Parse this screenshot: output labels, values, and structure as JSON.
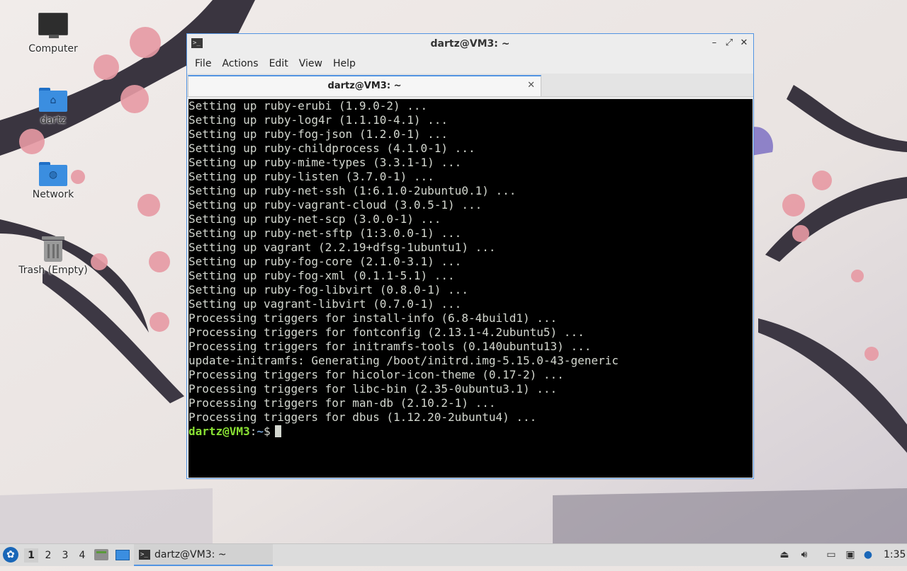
{
  "desktop": {
    "icons": [
      {
        "label": "Computer",
        "icon": "computer-icon"
      },
      {
        "label": "dartz",
        "icon": "home-folder-icon"
      },
      {
        "label": "Network",
        "icon": "network-folder-icon"
      },
      {
        "label": "Trash (Empty)",
        "icon": "trash-icon"
      }
    ]
  },
  "window": {
    "title": "dartz@VM3: ~",
    "controls": {
      "minimize": "–",
      "maximize": "⤢",
      "close": "✕"
    },
    "menu": [
      "File",
      "Actions",
      "Edit",
      "View",
      "Help"
    ],
    "tab": {
      "label": "dartz@VM3: ~",
      "close": "✕"
    }
  },
  "terminal": {
    "lines": [
      "Setting up ruby-erubi (1.9.0-2) ...",
      "Setting up ruby-log4r (1.1.10-4.1) ...",
      "Setting up ruby-fog-json (1.2.0-1) ...",
      "Setting up ruby-childprocess (4.1.0-1) ...",
      "Setting up ruby-mime-types (3.3.1-1) ...",
      "Setting up ruby-listen (3.7.0-1) ...",
      "Setting up ruby-net-ssh (1:6.1.0-2ubuntu0.1) ...",
      "Setting up ruby-vagrant-cloud (3.0.5-1) ...",
      "Setting up ruby-net-scp (3.0.0-1) ...",
      "Setting up ruby-net-sftp (1:3.0.0-1) ...",
      "Setting up vagrant (2.2.19+dfsg-1ubuntu1) ...",
      "Setting up ruby-fog-core (2.1.0-3.1) ...",
      "Setting up ruby-fog-xml (0.1.1-5.1) ...",
      "Setting up ruby-fog-libvirt (0.8.0-1) ...",
      "Setting up vagrant-libvirt (0.7.0-1) ...",
      "Processing triggers for install-info (6.8-4build1) ...",
      "Processing triggers for fontconfig (2.13.1-4.2ubuntu5) ...",
      "Processing triggers for initramfs-tools (0.140ubuntu13) ...",
      "update-initramfs: Generating /boot/initrd.img-5.15.0-43-generic",
      "Processing triggers for hicolor-icon-theme (0.17-2) ...",
      "Processing triggers for libc-bin (2.35-0ubuntu3.1) ...",
      "Processing triggers for man-db (2.10.2-1) ...",
      "Processing triggers for dbus (1.12.20-2ubuntu4) ..."
    ],
    "prompt": {
      "user_host": "dartz@VM3",
      "sep": ":",
      "path": "~",
      "symbol": "$"
    }
  },
  "taskbar": {
    "workspaces": [
      "1",
      "2",
      "3",
      "4"
    ],
    "active_workspace": "1",
    "task": {
      "label": "dartz@VM3: ~",
      "icon": "terminal-icon"
    },
    "tray_icons": [
      "eject-icon",
      "volume-icon",
      "clipboard-icon",
      "network-icon",
      "update-notifier-icon"
    ],
    "clock": "1:35"
  },
  "colors": {
    "accent": "#5294e2",
    "terminal_bg": "#000000",
    "terminal_fg": "#d3d7cf",
    "prompt_user": "#8ae234",
    "prompt_path": "#729fcf"
  }
}
